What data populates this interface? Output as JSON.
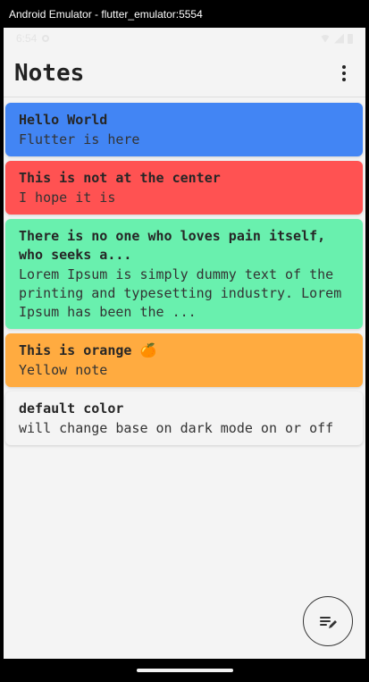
{
  "window": {
    "title": "Android Emulator - flutter_emulator:5554"
  },
  "status_bar": {
    "time": "6:54"
  },
  "app_bar": {
    "title": "Notes",
    "menu_icon": "more-vert-icon"
  },
  "notes": [
    {
      "title": "Hello World",
      "body": "Flutter is here",
      "color": "#4285f4"
    },
    {
      "title": "This is not at the center",
      "body": "I hope it is",
      "color": "#ff5252"
    },
    {
      "title": "There is no one who loves pain itself, who seeks a...",
      "body": "Lorem Ipsum is simply dummy text of the printing and typesetting industry. Lorem Ipsum has been the ...",
      "color": "#69f0ae"
    },
    {
      "title": "This is orange 🍊",
      "body": "Yellow note",
      "color": "#ffab40"
    },
    {
      "title": "default color",
      "body": "will change base on dark mode on or off",
      "color": "#f4f4f4"
    }
  ],
  "fab": {
    "icon": "edit-note-icon"
  }
}
